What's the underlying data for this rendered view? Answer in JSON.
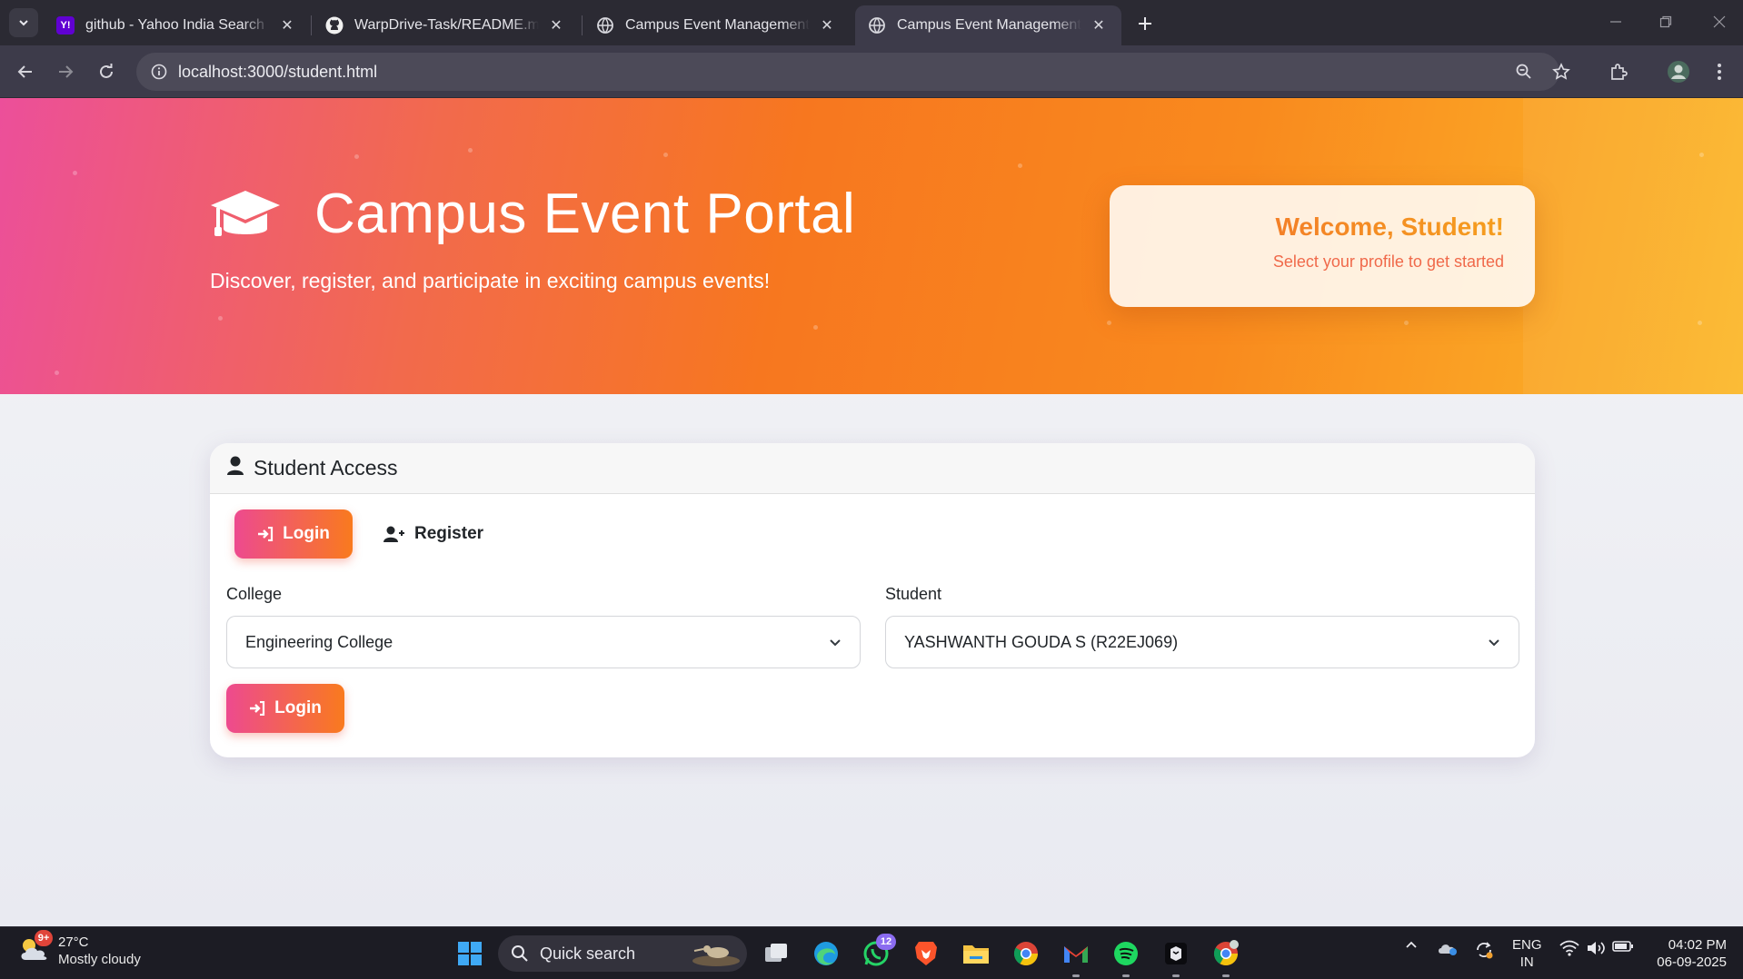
{
  "browser": {
    "tabs": [
      {
        "title": "github - Yahoo India Search Res",
        "favicon": "yahoo-icon"
      },
      {
        "title": "WarpDrive-Task/README.md at",
        "favicon": "github-icon"
      },
      {
        "title": "Campus Event Management Pla",
        "favicon": "globe-icon"
      },
      {
        "title": "Campus Event Management - S",
        "favicon": "globe-icon"
      }
    ],
    "address": "localhost:3000/student.html"
  },
  "hero": {
    "title": "Campus Event Portal",
    "subtitle": "Discover, register, and participate in exciting campus events!",
    "welcome_title": "Welcome, Student!",
    "welcome_subtitle": "Select your profile to get started",
    "gradient": [
      "#ec4f9a",
      "#f7771f",
      "#fbb82a"
    ]
  },
  "access": {
    "header": "Student Access",
    "tab_login": "Login",
    "tab_register": "Register",
    "college_label": "College",
    "college_value": "Engineering College",
    "student_label": "Student",
    "student_value": "YASHWANTH GOUDA S (R22EJ069)",
    "submit_label": "Login"
  },
  "taskbar": {
    "weather_temp": "27°C",
    "weather_cond": "Mostly cloudy",
    "weather_badge": "9+",
    "search_label": "Quick search",
    "whatsapp_badge": "12",
    "lang_top": "ENG",
    "lang_bottom": "IN",
    "time": "04:02 PM",
    "date": "06-09-2025"
  }
}
